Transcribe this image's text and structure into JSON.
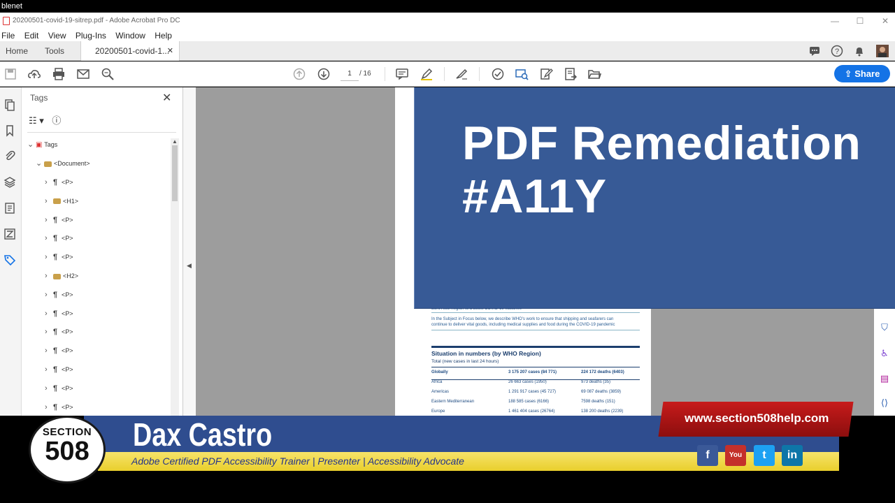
{
  "top_strip": {
    "text": "blenet"
  },
  "window": {
    "title": "20200501-covid-19-sitrep.pdf - Adobe Acrobat Pro DC",
    "controls": {
      "minimize": "—",
      "maximize": "☐",
      "close": "✕"
    }
  },
  "menu": [
    "File",
    "Edit",
    "View",
    "Plug-Ins",
    "Window",
    "Help"
  ],
  "tabs": {
    "home": "Home",
    "tools": "Tools",
    "doc": "20200501-covid-1...",
    "close": "✕"
  },
  "toolbar": {
    "page_current": "1",
    "page_total": "/ 16",
    "share_label": "Share"
  },
  "tags_panel": {
    "title": "Tags",
    "close": "✕",
    "root": "Tags",
    "document": "<Document>",
    "items": [
      "<P>",
      "<H1>",
      "<P>",
      "<P>",
      "<P>",
      "<H2>",
      "<P>",
      "<P>",
      "<P>",
      "<P>",
      "<P>",
      "<P>",
      "<P>"
    ]
  },
  "page_content": {
    "line1": "Euro Asia Region to a boost COVID-19 vaccines",
    "focus1": "In the Subject in Focus below, we describe WHO's work to ensure that shipping and seafarers can",
    "focus2": "continue to deliver vital goods, including medical supplies and food during the COVID-19 pandemic",
    "heading": "Situation in numbers (by WHO Region)",
    "subheading": "Total (new cases in last 24 hours)",
    "rows": [
      {
        "region": "Globally",
        "cases": "3 175 207 cases (84 771)",
        "deaths": "224 172 deaths (6403)"
      },
      {
        "region": "Africa",
        "cases": "26 663 cases (1950)",
        "deaths": "973 deaths (35)"
      },
      {
        "region": "Americas",
        "cases": "1 291 917 cases (45 727)",
        "deaths": "69 087 deaths (3859)"
      },
      {
        "region": "Eastern Mediterranean",
        "cases": "188 585 cases (6166)",
        "deaths": "7598 deaths (151)"
      },
      {
        "region": "Europe",
        "cases": "1 461 404 cases (26764)",
        "deaths": "138 200 deaths (2239)"
      }
    ]
  },
  "overlay": {
    "line1": "PDF Remediation",
    "line2": "#A11Y"
  },
  "lower_third": {
    "name": "Dax Castro",
    "role": "Adobe Certified PDF Accessibility Trainer | Presenter | Accessibility Advocate",
    "url": "www.section508help.com",
    "logo_top": "SECTION",
    "logo_num": "508",
    "social": [
      "f",
      "You",
      "t",
      "in"
    ]
  },
  "colors": {
    "overlay_blue": "#375a96",
    "share_blue": "#1473e6",
    "banner_red": "#c71b1b",
    "banner_yellow": "#f7e36a"
  }
}
